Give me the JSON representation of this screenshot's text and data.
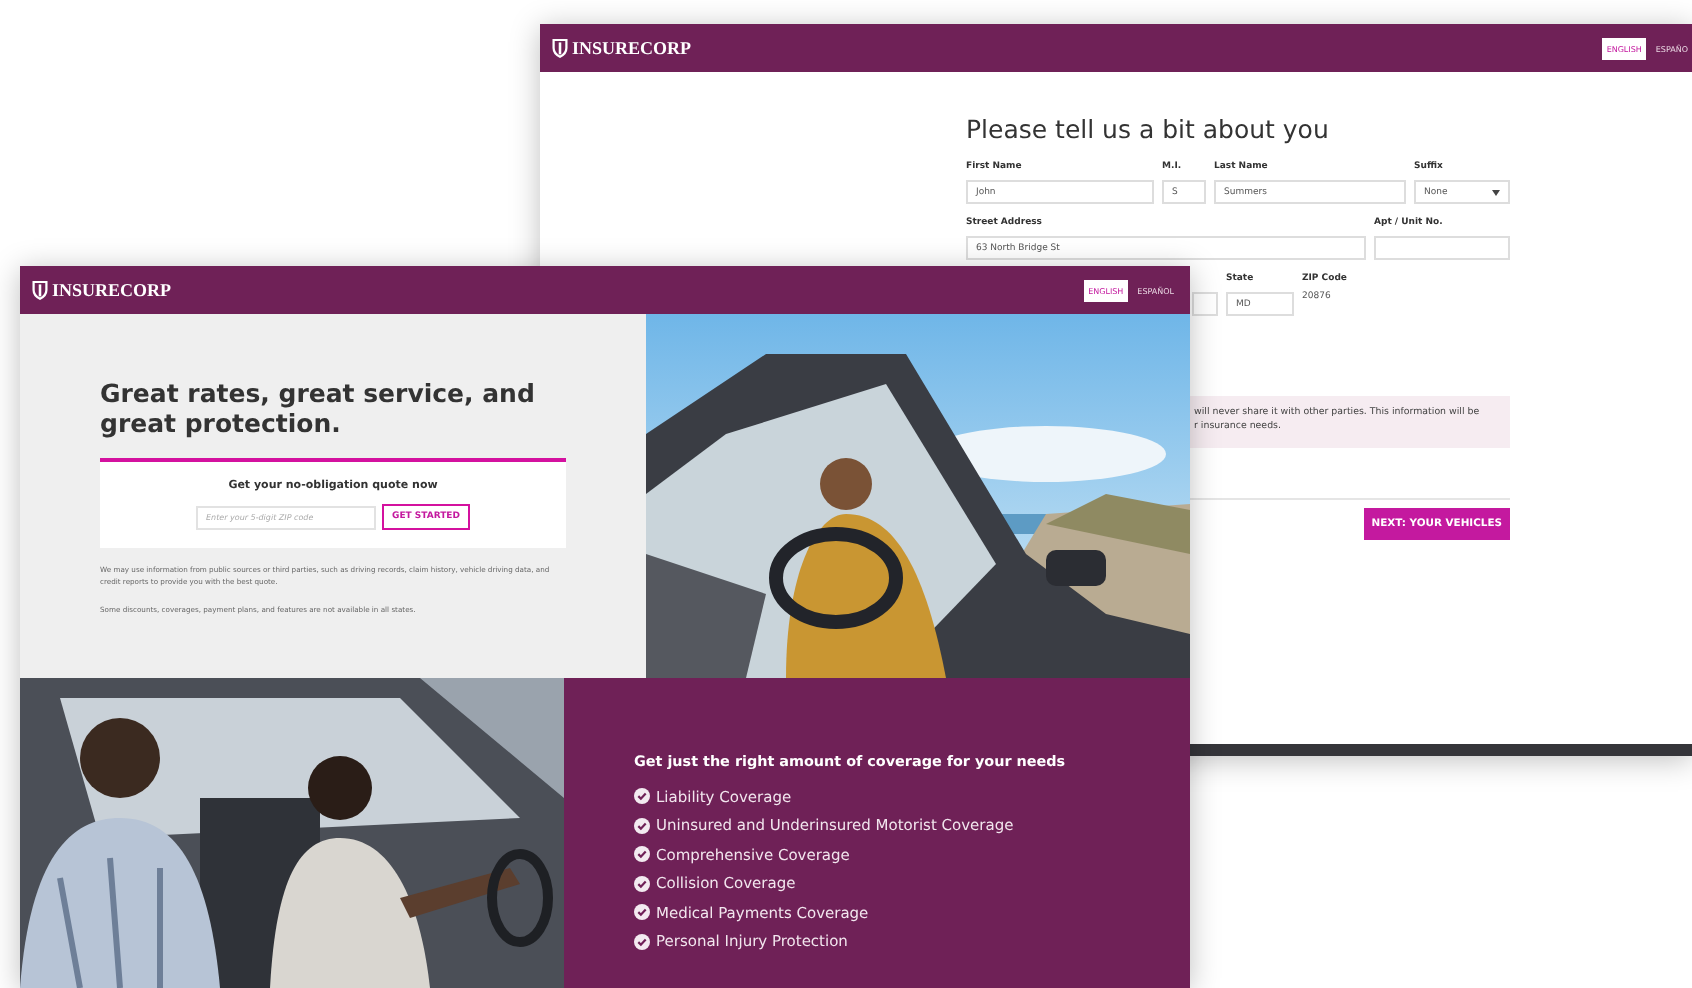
{
  "back_window": {
    "logo": "INSURECORP",
    "languages": [
      {
        "label": "ENGLISH",
        "selected": true
      },
      {
        "label": "ESPAÑO",
        "selected": false
      }
    ],
    "form": {
      "title": "Please tell us a bit about you",
      "fields": [
        {
          "kind": "text",
          "label": "First Name",
          "value": "John"
        },
        {
          "kind": "text",
          "label": "M.I.",
          "value": "S"
        },
        {
          "kind": "text",
          "label": "Last Name",
          "value": "Summers"
        },
        {
          "kind": "select",
          "label": "Suffix",
          "value": "None"
        },
        {
          "kind": "text",
          "label": "Street Address",
          "value": "63 North Bridge St"
        },
        {
          "kind": "text",
          "label": "Apt / Unit No."
        },
        {
          "kind": "text"
        },
        {
          "kind": "text",
          "label": "State",
          "value": "MD"
        },
        {
          "kind": "static",
          "label": "ZIP Code",
          "value": "20876"
        }
      ],
      "notice_lines": [
        "will never share it with other parties. This information will be",
        "r insurance needs."
      ],
      "next_button": "NEXT: YOUR VEHICLES"
    }
  },
  "front_window": {
    "logo": "INSURECORP",
    "languages": [
      {
        "label": "ENGLISH",
        "selected": true
      },
      {
        "label": "ESPAÑOL",
        "selected": false
      }
    ],
    "hero": {
      "headline": "Great rates, great service, and great protection.",
      "quote_card": {
        "title": "Get your no-obligation quote now",
        "placeholder": "Enter your 5-digit ZIP code",
        "button": "GET STARTED"
      },
      "disclaimers": [
        "We may use information from public sources or third parties, such as driving records, claim history, vehicle driving data, and credit reports to provide you with the best quote.",
        "Some discounts, coverages, payment plans, and features are not available in all states."
      ]
    },
    "coverage": {
      "title": "Get just the right amount of coverage for your needs",
      "items": [
        "Liability Coverage",
        "Uninsured and Underinsured Motorist Coverage",
        "Comprehensive Coverage",
        "Collision Coverage",
        "Medical Payments Coverage",
        "Personal Injury Protection"
      ]
    }
  }
}
